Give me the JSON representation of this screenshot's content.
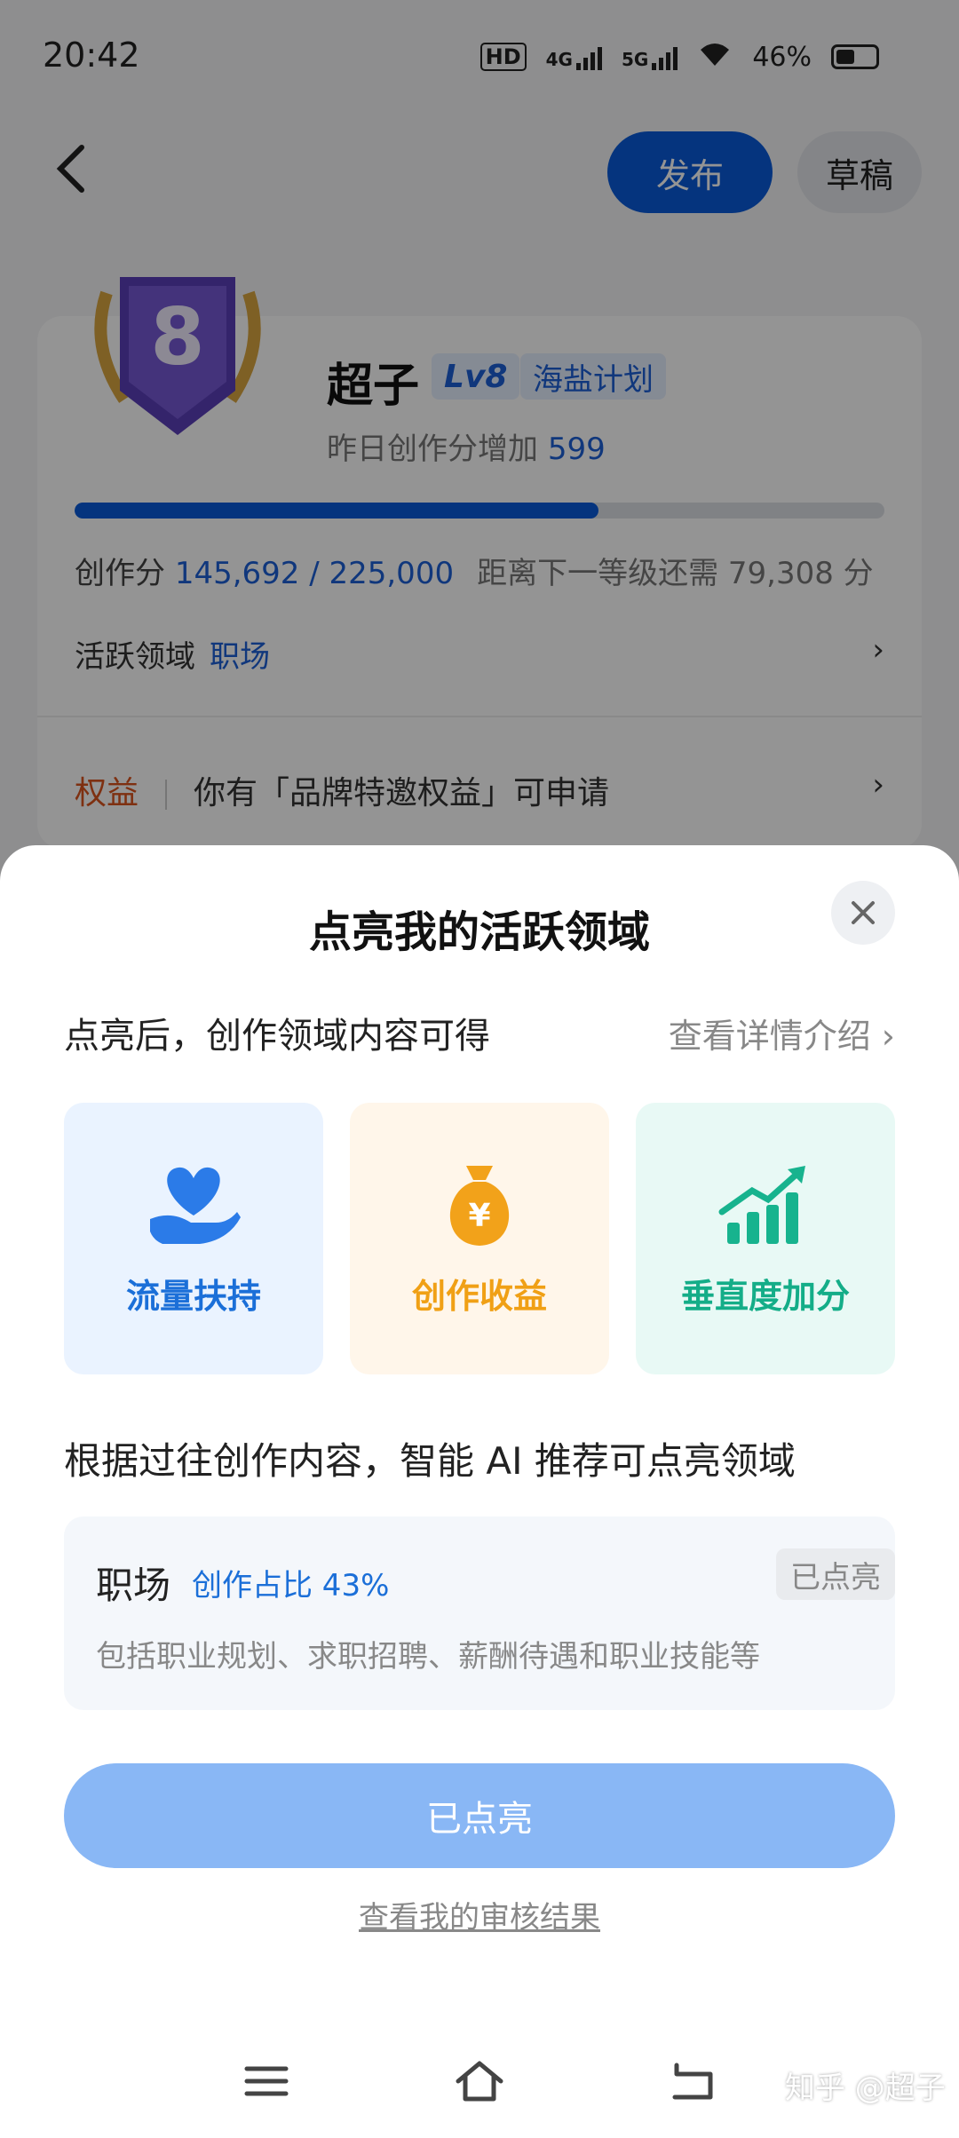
{
  "status_bar": {
    "time": "20:42",
    "hd": "HD",
    "net1": "4G",
    "net2": "5G",
    "battery": "46%"
  },
  "topbar": {
    "back_icon": "chevron-left-icon",
    "publish": "发布",
    "draft": "草稿"
  },
  "profile": {
    "badge_level": "8",
    "name": "超子",
    "level": "Lv8",
    "plan": "海盐计划",
    "yesterday_label": "昨日创作分增加",
    "yesterday_value": "599",
    "progress_fraction": 0.647,
    "score_label": "创作分",
    "score_value": "145,692 / 225,000",
    "next_level": "距离下一等级还需 79,308 分",
    "active_domain_label": "活跃领域",
    "active_domain_value": "职场",
    "rights_tag": "权益",
    "rights_text": "你有「品牌特邀权益」可申请"
  },
  "sheet": {
    "title": "点亮我的活跃领域",
    "subtitle": "点亮后，创作领域内容可得",
    "detail_link": "查看详情介绍 ›",
    "benefits": [
      {
        "label": "流量扶持",
        "icon": "heart-hand-icon",
        "color": "#1b6fd8"
      },
      {
        "label": "创作收益",
        "icon": "money-bag-icon",
        "color": "#f0a015"
      },
      {
        "label": "垂直度加分",
        "icon": "growth-chart-icon",
        "color": "#14ad88"
      }
    ],
    "ai_heading": "根据过往创作内容，智能 AI 推荐可点亮领域",
    "recommend": {
      "name": "职场",
      "ratio": "创作占比 43%",
      "status": "已点亮",
      "desc": "包括职业规划、求职招聘、薪酬待遇和职业技能等"
    },
    "button": "已点亮",
    "audit_link": "查看我的审核结果"
  },
  "navbar": {
    "menu_icon": "menu-icon",
    "home_icon": "home-icon",
    "back_icon": "back-icon"
  },
  "watermark": "知乎 @超子"
}
